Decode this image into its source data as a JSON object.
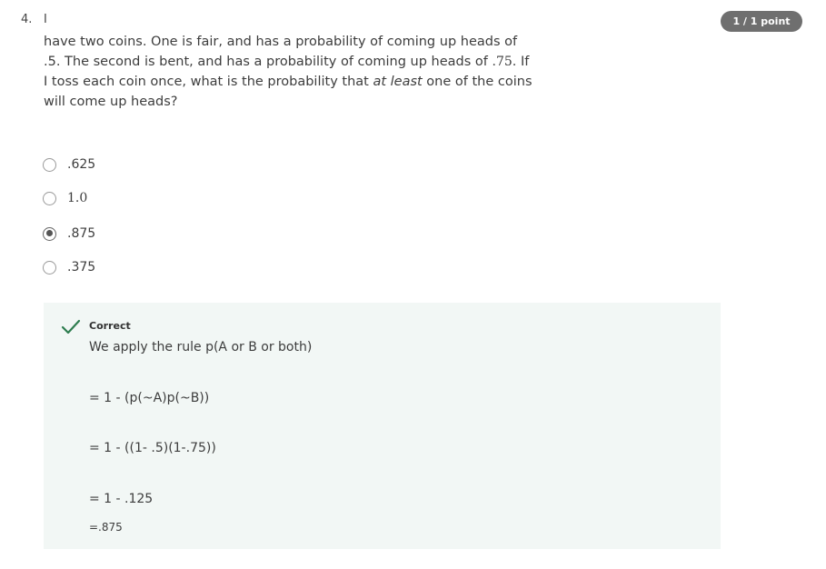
{
  "question": {
    "number": "4.",
    "first_char": "I",
    "text_part1": "have two coins. One is fair, and has a probability of coming up heads of .5. The second is bent, and has a probability of coming up heads of ",
    "text_math": ".75",
    "text_part2": ". If I toss each coin once, what is the probability that ",
    "text_emph": "at least",
    "text_part3": " one of the coins will come up heads?"
  },
  "score": {
    "label": "1 / 1 point"
  },
  "options": [
    {
      "label": ".625",
      "checked": false
    },
    {
      "label": "1.0",
      "checked": false
    },
    {
      "label": ".875",
      "checked": true
    },
    {
      "label": ".375",
      "checked": false
    }
  ],
  "feedback": {
    "status": "Correct",
    "status_color": "#2e7d4f",
    "lines": [
      "We apply the rule p(A or B or both)",
      "= 1 - (p(~A)p(~B))",
      "= 1 - ((1- .5)(1-.75))",
      "= 1 - .125",
      "=.875"
    ]
  }
}
